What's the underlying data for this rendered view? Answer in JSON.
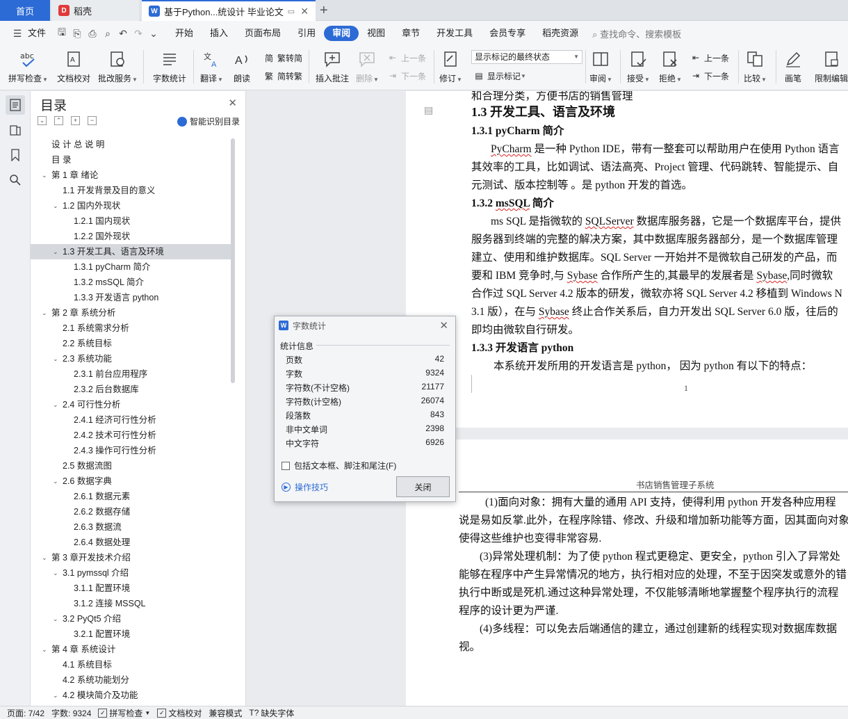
{
  "tabs": {
    "home": "首页",
    "docer": "稻壳",
    "document": "基于Python...统设计 毕业论文"
  },
  "menu": {
    "file": "文件",
    "items": [
      "开始",
      "插入",
      "页面布局",
      "引用",
      "审阅",
      "视图",
      "章节",
      "开发工具",
      "会员专享",
      "稻壳资源"
    ],
    "active": "审阅",
    "search": "查找命令、搜索模板"
  },
  "ribbon": {
    "spellcheck": "拼写检查",
    "doc_proof": "文档校对",
    "batch_service": "批改服务",
    "word_count": "字数统计",
    "translate": "翻译",
    "read_aloud": "朗读",
    "trad_to_simp": "繁转简",
    "simp_to_trad": "简转繁",
    "insert_comment": "插入批注",
    "delete": "删除",
    "prev": "上一条",
    "next": "下一条",
    "track_changes": "修订",
    "markup_state": "显示标记的最终状态",
    "show_markup": "显示标记",
    "review": "审阅",
    "accept": "接受",
    "reject": "拒绝",
    "prev2": "上一条",
    "next2": "下一条",
    "compare": "比较",
    "pen": "画笔",
    "restrict_edit": "限制编辑"
  },
  "outline": {
    "title": "目录",
    "smart_toc": "智能识别目录",
    "items": [
      {
        "text": "设 计 总 说 明",
        "level": 0,
        "toggle": ""
      },
      {
        "text": "目   录",
        "level": 0,
        "toggle": ""
      },
      {
        "text": "第 1 章  绪论",
        "level": 0,
        "toggle": "v"
      },
      {
        "text": "1.1  开发背景及目的意义",
        "level": 1,
        "toggle": ""
      },
      {
        "text": "1.2  国内外现状",
        "level": 1,
        "toggle": "v"
      },
      {
        "text": "1.2.1  国内现状",
        "level": 2,
        "toggle": ""
      },
      {
        "text": "1.2.2  国外现状",
        "level": 2,
        "toggle": ""
      },
      {
        "text": "1.3  开发工具、语言及环境",
        "level": 1,
        "toggle": "v",
        "selected": true
      },
      {
        "text": "1.3.1    pyCharm  简介",
        "level": 2,
        "toggle": ""
      },
      {
        "text": "1.3.2    msSQL 简介",
        "level": 2,
        "toggle": ""
      },
      {
        "text": "1.3.3  开发语言 python",
        "level": 2,
        "toggle": ""
      },
      {
        "text": "第 2 章  系统分析",
        "level": 0,
        "toggle": "v"
      },
      {
        "text": "2.1  系统需求分析",
        "level": 1,
        "toggle": ""
      },
      {
        "text": "2.2  系统目标",
        "level": 1,
        "toggle": ""
      },
      {
        "text": "2.3  系统功能",
        "level": 1,
        "toggle": "v"
      },
      {
        "text": "2.3.1  前台应用程序",
        "level": 2,
        "toggle": ""
      },
      {
        "text": "2.3.2  后台数据库",
        "level": 2,
        "toggle": ""
      },
      {
        "text": "2.4  可行性分析",
        "level": 1,
        "toggle": "v"
      },
      {
        "text": "2.4.1  经济可行性分析",
        "level": 2,
        "toggle": ""
      },
      {
        "text": "2.4.2  技术可行性分析",
        "level": 2,
        "toggle": ""
      },
      {
        "text": "2.4.3  操作可行性分析",
        "level": 2,
        "toggle": ""
      },
      {
        "text": "2.5  数据流图",
        "level": 1,
        "toggle": ""
      },
      {
        "text": "2.6 数据字典",
        "level": 1,
        "toggle": "v"
      },
      {
        "text": "2.6.1  数据元素",
        "level": 2,
        "toggle": ""
      },
      {
        "text": "2.6.2 数据存储",
        "level": 2,
        "toggle": ""
      },
      {
        "text": "2.6.3  数据流",
        "level": 2,
        "toggle": ""
      },
      {
        "text": "2.6.4  数据处理",
        "level": 2,
        "toggle": ""
      },
      {
        "text": "第 3 章开发技术介绍",
        "level": 0,
        "toggle": "v"
      },
      {
        "text": "3.1 pymssql 介绍",
        "level": 1,
        "toggle": "v"
      },
      {
        "text": "3.1.1  配置环境",
        "level": 2,
        "toggle": ""
      },
      {
        "text": "3.1.2  连接 MSSQL",
        "level": 2,
        "toggle": ""
      },
      {
        "text": "3.2 PyQt5 介绍",
        "level": 1,
        "toggle": "v"
      },
      {
        "text": "3.2.1  配置环境",
        "level": 2,
        "toggle": ""
      },
      {
        "text": "第 4 章  系统设计",
        "level": 0,
        "toggle": "v"
      },
      {
        "text": "4.1  系统目标",
        "level": 1,
        "toggle": ""
      },
      {
        "text": "4.2  系统功能划分",
        "level": 1,
        "toggle": ""
      },
      {
        "text": "4.2  模块简介及功能",
        "level": 1,
        "toggle": "v"
      }
    ]
  },
  "page1": {
    "top_line": "和合理分类，方便书店的销售管理",
    "h_1_3": "1.3  开发工具、语言及环境",
    "h_1_3_1": "1.3.1    pyCharm  简介",
    "pycharm_l1a": "PyCharm",
    "pycharm_l1b": " 是一种 Python IDE，带有一整套可以帮助用户在使用 Python 语言",
    "pycharm_l2": "其效率的工具，比如调试、语法高亮、Project 管理、代码跳转、智能提示、自",
    "pycharm_l3": "元测试、版本控制等  。是 python 开发的首选。",
    "h_1_3_2a": "1.3.2    ",
    "h_1_3_2b": "msSQL",
    "h_1_3_2c": " 简介",
    "ms_l1a": "ms SQL 是指微软的 ",
    "ms_l1b": "SQLServer",
    "ms_l1c": " 数据库服务器，它是一个数据库平台，提供",
    "ms_l2": "服务器到终端的完整的解决方案，其中数据库服务器部分，是一个数据库管理",
    "ms_l3": "建立、使用和维护数据库。SQL Server 一开始并不是微软自己研发的产品，而",
    "ms_l4a": "要和 IBM 竞争时,与 ",
    "ms_l4b": "Sybase",
    "ms_l4c": " 合作所产生的,其最早的发展者是 ",
    "ms_l4d": "Sybase",
    "ms_l4e": ",同时微软",
    "ms_l5": "合作过  SQL Server 4.2 版本的研发，微软亦将 SQL Server 4.2 移植到 Windows N",
    "ms_l6a": "3.1 版），在与 ",
    "ms_l6b": "Sybase",
    "ms_l6c": " 终止合作关系后，自力开发出 SQL Server 6.0 版，往后的",
    "ms_l7": "即均由微软自行研发。",
    "h_1_3_3": "1.3.3  开发语言 python",
    "py_l1": "本系统开发所用的开发语言是 python，  因为 python 有以下的特点：",
    "page_number": "1"
  },
  "page2": {
    "header": "书店销售管理子系统",
    "l1": "(1)面向对象：拥有大量的通用 API 支持，使得利用 python 开发各种应用程",
    "l2": "说是易如反掌.此外，在程序除错、修改、升级和增加新功能等方面，因其面向对象",
    "l3": "使得这些维护也变得非常容易.",
    "l4": "(3)异常处理机制：为了使 python 程式更稳定、更安全，python 引入了异常处",
    "l5": "能够在程序中产生异常情况的地方，执行相对应的处理，不至于因突发或意外的错",
    "l6": "执行中断或是死机.通过这种异常处理，不仅能够清晰地掌握整个程序执行的流程",
    "l7": "程序的设计更为严谨.",
    "l8": "(4)多线程：可以免去后端通信的建立，通过创建新的线程实现对数据库数据",
    "l9": "视。"
  },
  "dialog": {
    "title": "字数统计",
    "group": "统计信息",
    "rows": [
      {
        "label": "页数",
        "value": "42"
      },
      {
        "label": "字数",
        "value": "9324"
      },
      {
        "label": "字符数(不计空格)",
        "value": "21177"
      },
      {
        "label": "字符数(计空格)",
        "value": "26074"
      },
      {
        "label": "段落数",
        "value": "843"
      },
      {
        "label": "非中文单词",
        "value": "2398"
      },
      {
        "label": "中文字符",
        "value": "6926"
      }
    ],
    "checkbox": "包括文本框、脚注和尾注(F)",
    "tips": "操作技巧",
    "close": "关闭"
  },
  "status": {
    "page": "页面: 7/42",
    "words": "字数: 9324",
    "spellcheck": "拼写检查",
    "proof": "文档校对",
    "compat": "兼容模式",
    "missing_font": "缺失字体"
  },
  "colors": {
    "accent": "#2c6bd6",
    "selected_row": "#d5d8dd",
    "dialog_bg": "#f4f5f7"
  }
}
